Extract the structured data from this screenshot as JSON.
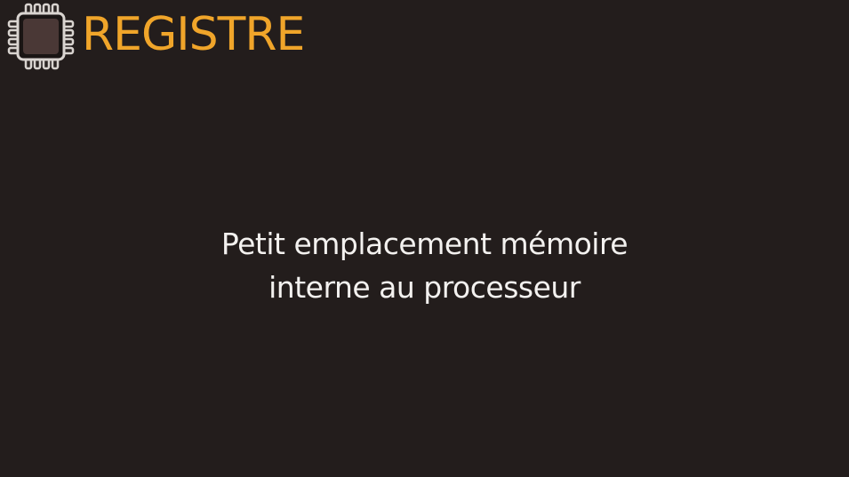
{
  "slide": {
    "icon": "chip-icon",
    "title": "REGISTRE",
    "definition_lines": [
      "Petit emplacement mémoire",
      "interne au processeur"
    ],
    "colors": {
      "background": "#231d1c",
      "title": "#f0a52a",
      "text": "#f3f1ef"
    }
  }
}
